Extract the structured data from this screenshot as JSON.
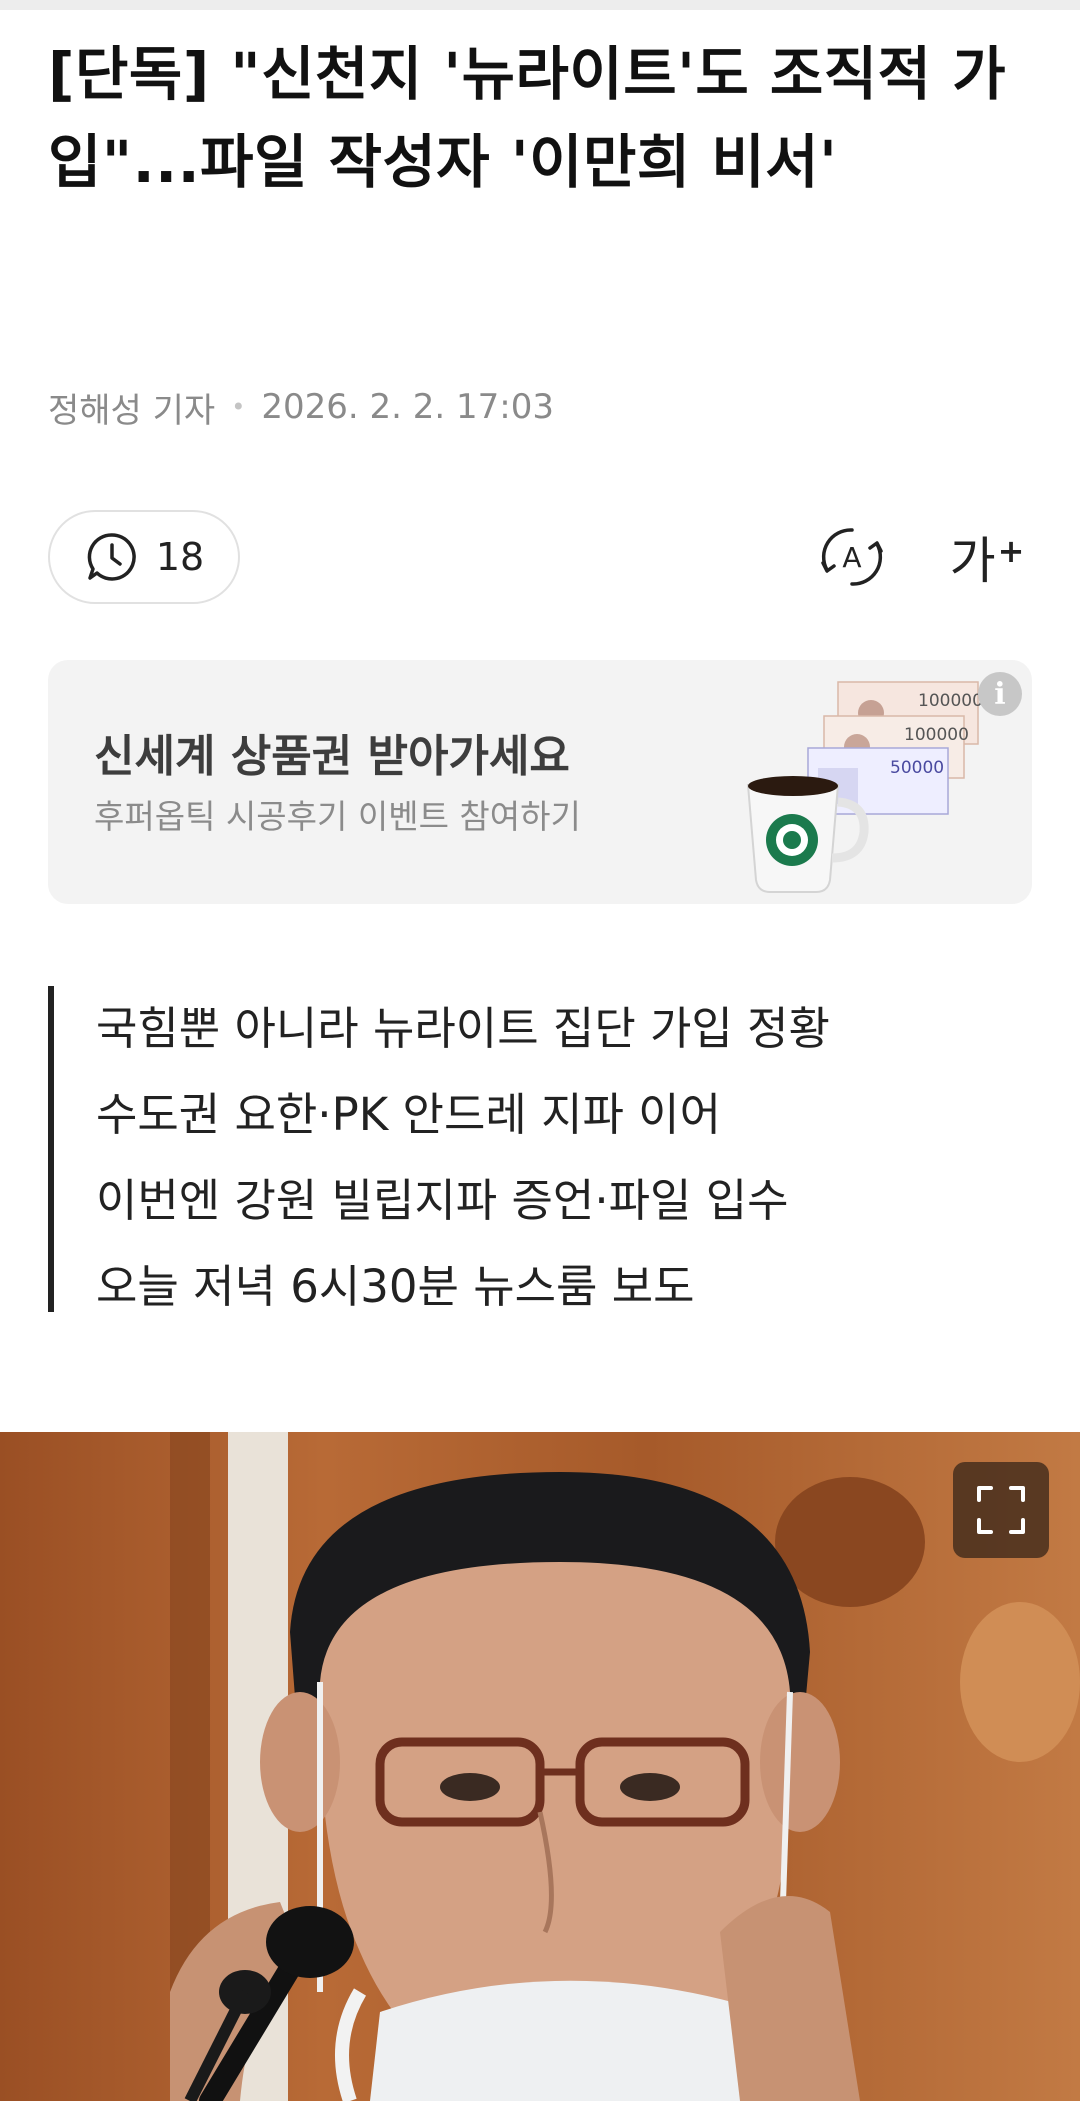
{
  "article": {
    "headline": "[단독] \"신천지 '뉴라이트'도 조직적 가입\"...파일 작성자 '이만희 비서'",
    "reporter": "정해성 기자",
    "datetime": "2026. 2. 2. 17:03"
  },
  "toolbar": {
    "comment_count": "18",
    "font_size_label": "가",
    "font_size_plus": "+"
  },
  "ad": {
    "title": "신세계 상품권 받아가세요",
    "subtitle": "후퍼옵틱 시공후기 이벤트 참여하기",
    "info_symbol": "i",
    "voucher_values": [
      "100000",
      "100000",
      "50000"
    ]
  },
  "summary": {
    "lines": [
      "국힘뿐 아니라 뉴라이트 집단 가입 정황",
      "수도권 요한·PK 안드레 지파 이어",
      "이번엔 강원 빌립지파 증언·파일 입수",
      "오늘 저녁 6시30분 뉴스룸 보도"
    ]
  },
  "colors": {
    "background": "#ffffff",
    "ad_background": "#f3f3f3",
    "summary_bar": "#222222",
    "meta_text": "#8a8a8a"
  },
  "icons": {
    "comment": "clock-speech-bubble-icon",
    "reader": "auto-read-icon",
    "font_size": "font-size-plus-icon",
    "expand": "expand-fullscreen-icon",
    "ad_info": "info-icon"
  }
}
